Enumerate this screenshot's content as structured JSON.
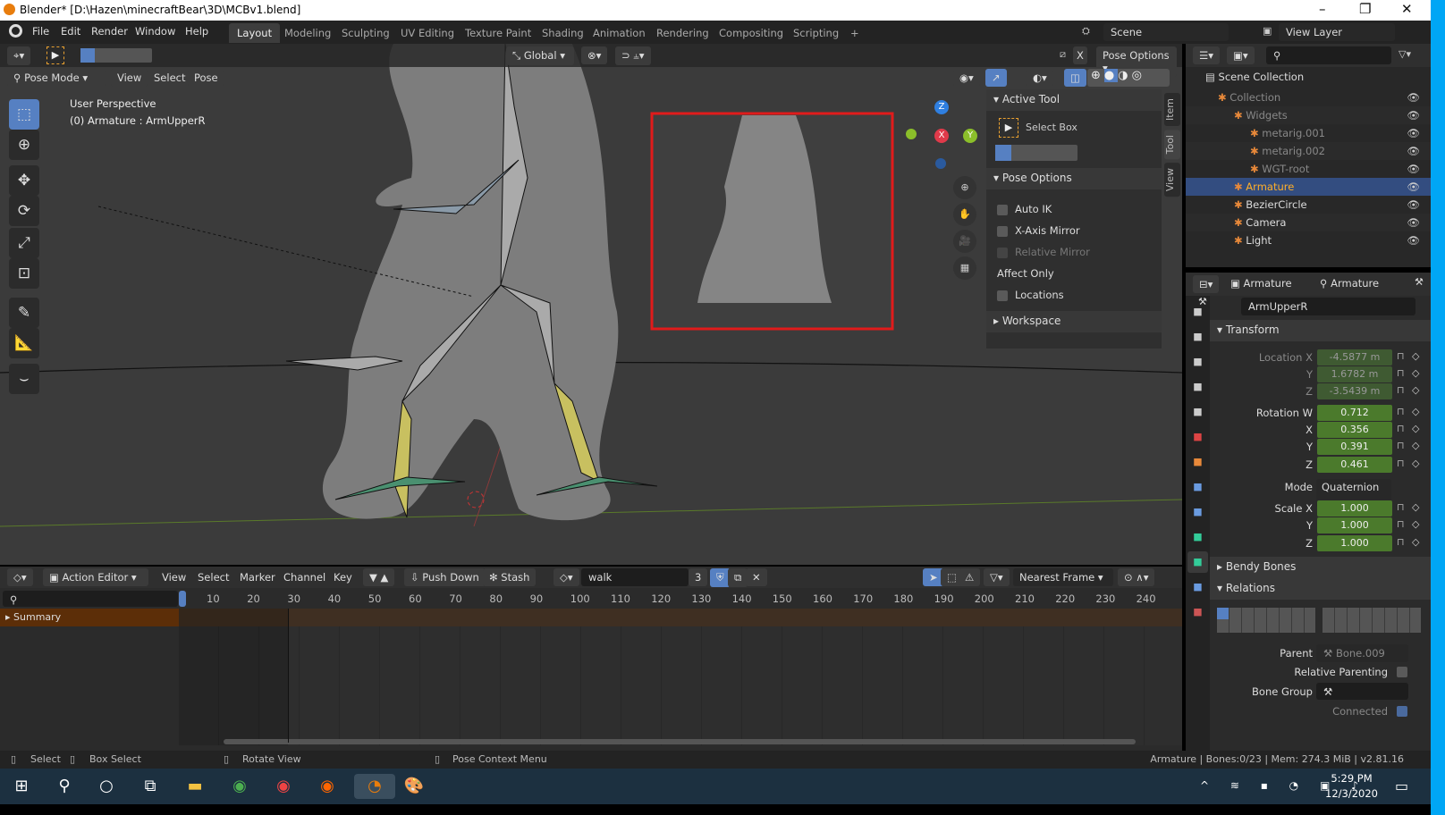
{
  "window": {
    "title": "Blender* [D:\\Hazen\\minecraftBear\\3D\\MCBv1.blend]",
    "minimize": "–",
    "maximize": "❐",
    "close": "✕"
  },
  "menu": [
    "File",
    "Edit",
    "Render",
    "Window",
    "Help"
  ],
  "workspaces": [
    "Layout",
    "Modeling",
    "Sculpting",
    "UV Editing",
    "Texture Paint",
    "Shading",
    "Animation",
    "Rendering",
    "Compositing",
    "Scripting",
    "+"
  ],
  "scene": {
    "scene_name": "Scene",
    "view_layer": "View Layer"
  },
  "viewport": {
    "mode": "Pose Mode",
    "menus": [
      "View",
      "Select",
      "Pose"
    ],
    "orientation": "Global",
    "pose_options": "Pose Options",
    "x_mirror": "X",
    "overlay_line1": "User Perspective",
    "overlay_line2": "(0) Armature : ArmUpperR",
    "gizmo": {
      "x": "X",
      "y": "Y",
      "z": "Z"
    }
  },
  "npanel": {
    "active_tool": "Active Tool",
    "select_box": "Select Box",
    "pose_options": "Pose Options",
    "auto_ik": "Auto IK",
    "x_axis_mirror": "X-Axis Mirror",
    "relative_mirror": "Relative Mirror",
    "affect_only": "Affect Only",
    "locations": "Locations",
    "workspace": "Workspace",
    "tabs": [
      "Item",
      "Tool",
      "View"
    ]
  },
  "outliner": {
    "root": "Scene Collection",
    "items": [
      {
        "label": "Collection",
        "indent": 1,
        "dim": true
      },
      {
        "label": "Widgets",
        "indent": 2,
        "dim": true
      },
      {
        "label": "metarig.001",
        "indent": 3,
        "dim": true
      },
      {
        "label": "metarig.002",
        "indent": 3,
        "dim": true
      },
      {
        "label": "WGT-root",
        "indent": 3,
        "dim": true
      },
      {
        "label": "Armature",
        "indent": 2,
        "selected": true
      },
      {
        "label": "BezierCircle",
        "indent": 2
      },
      {
        "label": "Camera",
        "indent": 2
      },
      {
        "label": "Light",
        "indent": 2
      }
    ]
  },
  "properties": {
    "breadcrumb": [
      "Armature",
      "Armature"
    ],
    "bone_name": "ArmUpperR",
    "transform": "Transform",
    "location": {
      "label": "Location X",
      "x": "-4.5877 m",
      "y": "1.6782 m",
      "z": "-3.5439 m"
    },
    "rotation": {
      "label": "Rotation W",
      "w": "0.712",
      "x": "0.356",
      "y": "0.391",
      "z": "0.461"
    },
    "mode_label": "Mode",
    "mode": "Quaternion ...",
    "scale": {
      "label": "Scale X",
      "x": "1.000",
      "y": "1.000",
      "z": "1.000"
    },
    "axis": {
      "x": "X",
      "y": "Y",
      "z": "Z"
    },
    "bendy_bones": "Bendy Bones",
    "relations": "Relations",
    "parent_label": "Parent",
    "parent": "Bone.009",
    "relative_parenting": "Relative Parenting",
    "bone_group": "Bone Group",
    "connected": "Connected"
  },
  "action_editor": {
    "editor": "Action Editor",
    "menus": [
      "View",
      "Select",
      "Marker",
      "Channel",
      "Key"
    ],
    "push_down": "Push Down",
    "stash": "Stash",
    "action": "walk",
    "users": "3",
    "snap": "Nearest Frame",
    "summary": "Summary",
    "frames": [
      "10",
      "20",
      "30",
      "40",
      "50",
      "60",
      "70",
      "80",
      "90",
      "100",
      "110",
      "120",
      "130",
      "140",
      "150",
      "160",
      "170",
      "180",
      "190",
      "200",
      "210",
      "220",
      "230",
      "240"
    ]
  },
  "status": {
    "select": "Select",
    "box_select": "Box Select",
    "rotate_view": "Rotate View",
    "context_menu": "Pose Context Menu",
    "info": "Armature | Bones:0/23  | Mem: 274.3 MiB | v2.81.16"
  },
  "taskbar": {
    "time": "5:29 PM",
    "date": "12/3/2020"
  }
}
